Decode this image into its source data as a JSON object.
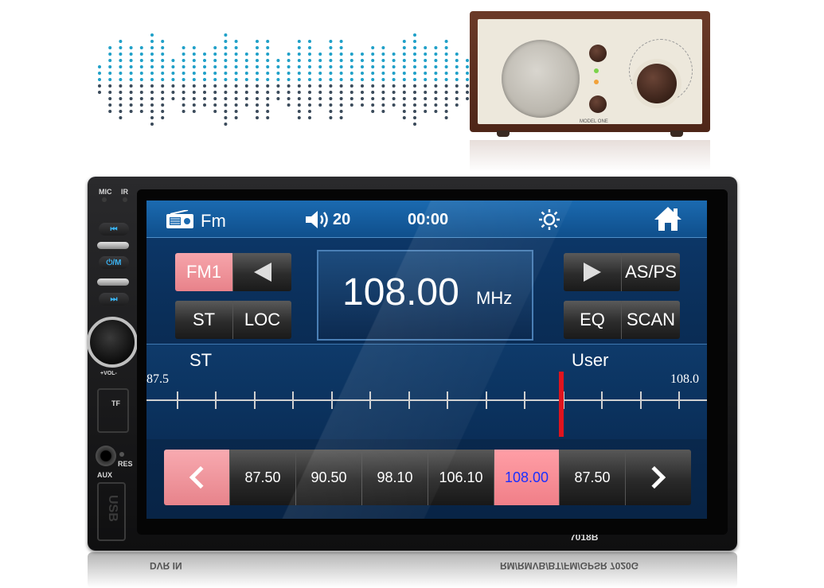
{
  "radio": {
    "model_label": "MODEL ONE"
  },
  "unit": {
    "mic_label": "MIC",
    "ir_label": "IR",
    "prev_icon": "prev-track-icon",
    "power_mode_label": "⏻/M",
    "next_icon": "next-track-icon",
    "vol_label": "+VOL-",
    "tf_label": "TF",
    "res_label": "RES",
    "aux_label": "AUX",
    "usb_label": "USB",
    "model_label": "7018B",
    "reflect_left": "DVR IN",
    "reflect_right": "RM/RMVB/BT/FM/GPSR  7020G"
  },
  "topbar": {
    "mode_icon": "radio-icon",
    "mode_label": "Fm",
    "volume_icon": "speaker-icon",
    "volume_value": "20",
    "clock": "00:00",
    "brightness_icon": "brightness-icon",
    "home_icon": "home-icon"
  },
  "controls": {
    "band_label": "FM1",
    "seek_back_icon": "seek-back-icon",
    "st_label": "ST",
    "loc_label": "LOC",
    "seek_fwd_icon": "seek-forward-icon",
    "asps_label": "AS/PS",
    "eq_label": "EQ",
    "scan_label": "SCAN"
  },
  "display": {
    "frequency": "108.00",
    "unit": "MHz"
  },
  "tuner": {
    "stereo_label": "ST",
    "eq_mode_label": "User",
    "min_label": "87.5",
    "max_label": "108.0",
    "min": 87.5,
    "max": 108.0,
    "current": 108.0
  },
  "presets": {
    "prev_icon": "chevron-left-icon",
    "next_icon": "chevron-right-icon",
    "items": [
      "87.50",
      "90.50",
      "98.10",
      "106.10",
      "108.00",
      "87.50"
    ],
    "active_index": 4
  },
  "colors": {
    "accent_blue": "#3ab5f5",
    "active_pink": "#f07f88",
    "active_text": "#1b2fff",
    "needle_red": "#e0141e"
  }
}
